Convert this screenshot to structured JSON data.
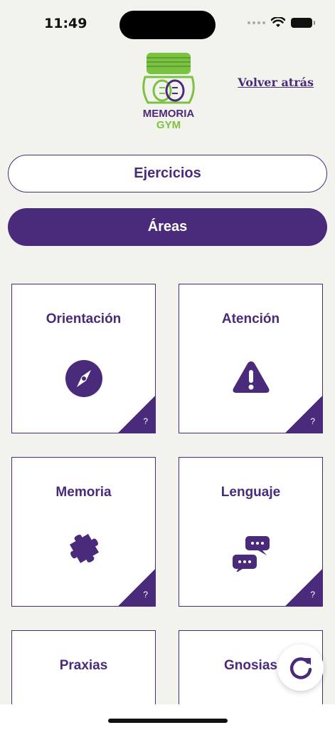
{
  "status_bar": {
    "time": "11:49"
  },
  "header": {
    "logo_text_line1": "MEMORIA",
    "logo_text_line2": "GYM",
    "back_link": "Volver atrás"
  },
  "tabs": {
    "exercises_label": "Ejercicios",
    "areas_label": "Áreas",
    "active": "Áreas"
  },
  "cards": [
    {
      "title": "Orientación",
      "icon": "compass-icon",
      "help": "?"
    },
    {
      "title": "Atención",
      "icon": "warning-icon",
      "help": "?"
    },
    {
      "title": "Memoria",
      "icon": "puzzle-icon",
      "help": "?"
    },
    {
      "title": "Lenguaje",
      "icon": "chat-bubbles-icon",
      "help": "?"
    },
    {
      "title": "Praxias",
      "icon": "",
      "help": ""
    },
    {
      "title": "Gnosias",
      "icon": "",
      "help": ""
    }
  ],
  "colors": {
    "primary": "#4a2a7a",
    "background": "#f3f3ee",
    "logo_green": "#7bc142"
  }
}
